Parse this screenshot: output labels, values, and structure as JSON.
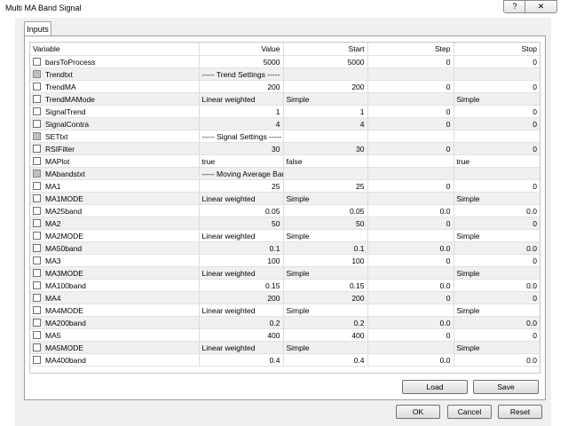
{
  "window": {
    "title": "Multi MA Band Signal",
    "help_label": "?",
    "close_label": "✕"
  },
  "tab": {
    "label": "Inputs"
  },
  "columns": [
    "Variable",
    "Value",
    "Start",
    "Step",
    "Stop"
  ],
  "rows": [
    {
      "name": "barsToProcess",
      "value": "5000",
      "start": "5000",
      "step": "0",
      "stop": "0",
      "checkbox": "normal"
    },
    {
      "name": "Trendtxt",
      "value": "----- Trend Settings -----",
      "start": "",
      "step": "",
      "stop": "",
      "checkbox": "inactive"
    },
    {
      "name": "TrendMA",
      "value": "200",
      "start": "200",
      "step": "0",
      "stop": "0",
      "checkbox": "normal"
    },
    {
      "name": "TrendMAMode",
      "value": "Linear weighted",
      "start": "Simple",
      "step": "",
      "stop": "Simple",
      "checkbox": "normal"
    },
    {
      "name": "SignalTrend",
      "value": "1",
      "start": "1",
      "step": "0",
      "stop": "0",
      "checkbox": "normal"
    },
    {
      "name": "SignalContra",
      "value": "4",
      "start": "4",
      "step": "0",
      "stop": "0",
      "checkbox": "normal"
    },
    {
      "name": "SETtxt",
      "value": "----- Signal Settings -----",
      "start": "",
      "step": "",
      "stop": "",
      "checkbox": "inactive"
    },
    {
      "name": "RSIFilter",
      "value": "30",
      "start": "30",
      "step": "0",
      "stop": "0",
      "checkbox": "normal"
    },
    {
      "name": "MAPlot",
      "value": "true",
      "start": "false",
      "step": "",
      "stop": "true",
      "checkbox": "normal"
    },
    {
      "name": "MAbandstxt",
      "value": "----- Moving Average Bands -----",
      "start": "",
      "step": "",
      "stop": "",
      "checkbox": "inactive"
    },
    {
      "name": "MA1",
      "value": "25",
      "start": "25",
      "step": "0",
      "stop": "0",
      "checkbox": "normal"
    },
    {
      "name": "MA1MODE",
      "value": "Linear weighted",
      "start": "Simple",
      "step": "",
      "stop": "Simple",
      "checkbox": "normal"
    },
    {
      "name": "MA25band",
      "value": "0.05",
      "start": "0.05",
      "step": "0.0",
      "stop": "0.0",
      "checkbox": "normal"
    },
    {
      "name": "MA2",
      "value": "50",
      "start": "50",
      "step": "0",
      "stop": "0",
      "checkbox": "normal"
    },
    {
      "name": "MA2MODE",
      "value": "Linear weighted",
      "start": "Simple",
      "step": "",
      "stop": "Simple",
      "checkbox": "normal"
    },
    {
      "name": "MA50band",
      "value": "0.1",
      "start": "0.1",
      "step": "0.0",
      "stop": "0.0",
      "checkbox": "normal"
    },
    {
      "name": "MA3",
      "value": "100",
      "start": "100",
      "step": "0",
      "stop": "0",
      "checkbox": "normal"
    },
    {
      "name": "MA3MODE",
      "value": "Linear weighted",
      "start": "Simple",
      "step": "",
      "stop": "Simple",
      "checkbox": "normal"
    },
    {
      "name": "MA100band",
      "value": "0.15",
      "start": "0.15",
      "step": "0.0",
      "stop": "0.0",
      "checkbox": "normal"
    },
    {
      "name": "MA4",
      "value": "200",
      "start": "200",
      "step": "0",
      "stop": "0",
      "checkbox": "normal"
    },
    {
      "name": "MA4MODE",
      "value": "Linear weighted",
      "start": "Simple",
      "step": "",
      "stop": "Simple",
      "checkbox": "normal"
    },
    {
      "name": "MA200band",
      "value": "0.2",
      "start": "0.2",
      "step": "0.0",
      "stop": "0.0",
      "checkbox": "normal"
    },
    {
      "name": "MA5",
      "value": "400",
      "start": "400",
      "step": "0",
      "stop": "0",
      "checkbox": "normal"
    },
    {
      "name": "MA5MODE",
      "value": "Linear weighted",
      "start": "Simple",
      "step": "",
      "stop": "Simple",
      "checkbox": "normal"
    },
    {
      "name": "MA400band",
      "value": "0.4",
      "start": "0.4",
      "step": "0.0",
      "stop": "0.0",
      "checkbox": "normal"
    }
  ],
  "buttons": {
    "load": "Load",
    "save": "Save",
    "ok": "OK",
    "cancel": "Cancel",
    "reset": "Reset"
  }
}
